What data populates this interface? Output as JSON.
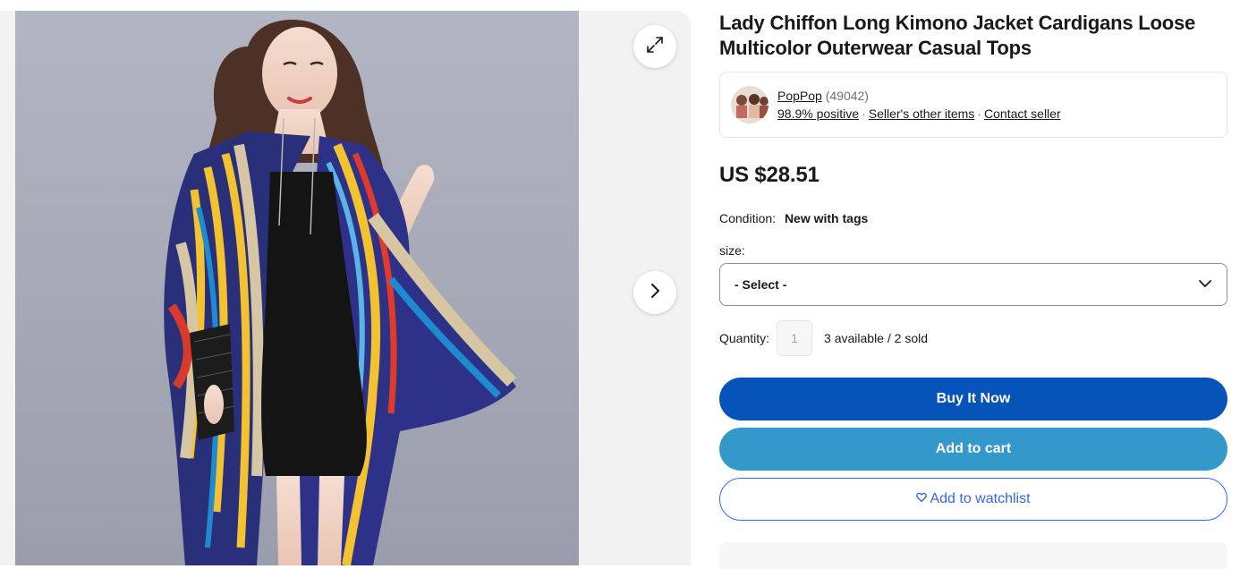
{
  "gallery": {
    "expand_icon": "expand-icon",
    "next_icon": "chevron-right-icon"
  },
  "product": {
    "title": "Lady Chiffon Long Kimono Jacket Cardigans Loose Multicolor Outerwear Casual Tops",
    "price": "US $28.51"
  },
  "seller": {
    "name": "PopPop",
    "feedback_count": "(49042)",
    "positive": "98.9% positive",
    "other_items": "Seller's other items",
    "contact": "Contact seller"
  },
  "condition": {
    "label": "Condition:",
    "value": "New with tags"
  },
  "size": {
    "label": "size:",
    "selected": "- Select -"
  },
  "quantity": {
    "label": "Quantity:",
    "value": "1",
    "availability": "3 available / 2 sold"
  },
  "buttons": {
    "buy_now": "Buy It Now",
    "add_to_cart": "Add to cart",
    "watchlist": "Add to watchlist"
  },
  "colors": {
    "buy_now": "#0654ba",
    "add_to_cart": "#3498ca",
    "watchlist": "#3665f3"
  }
}
